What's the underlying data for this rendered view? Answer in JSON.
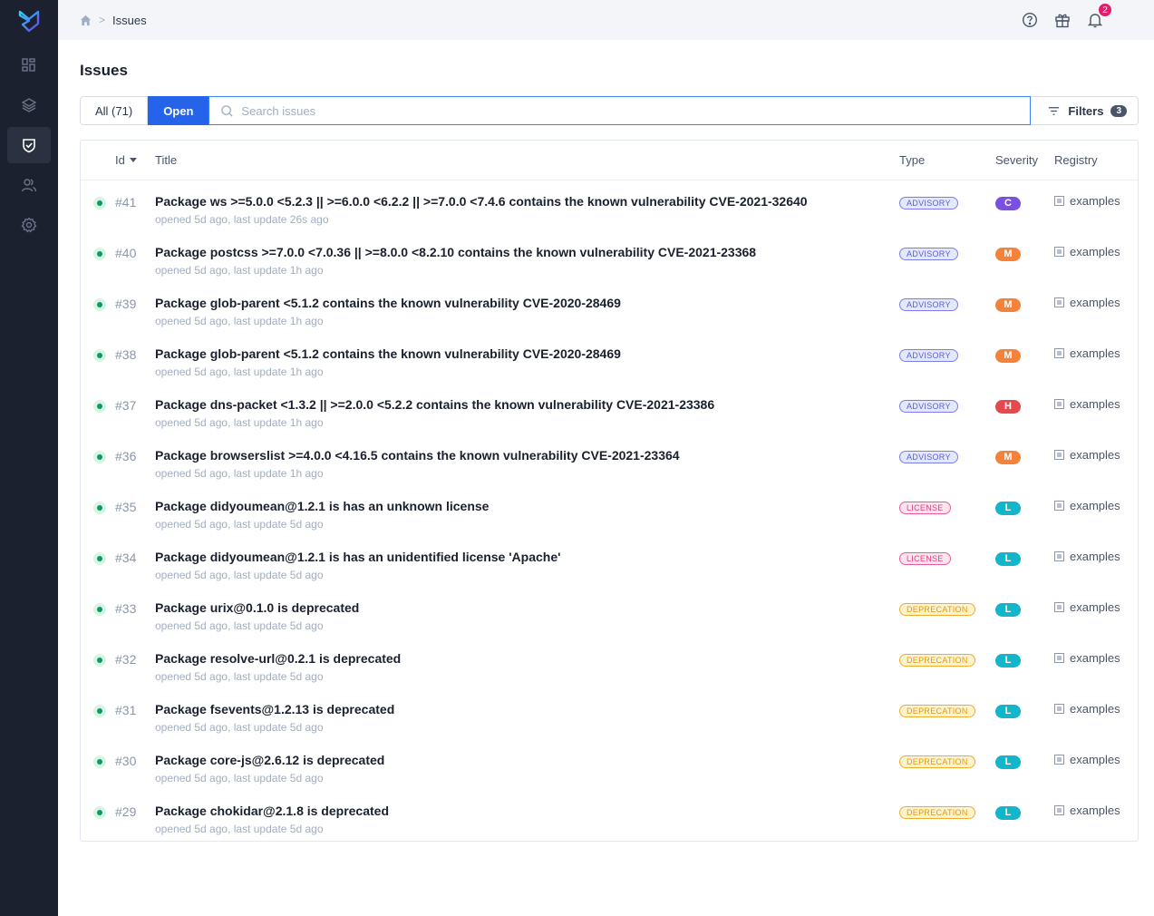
{
  "sidebar": {
    "logo": "app-logo",
    "items": [
      {
        "name": "dashboard",
        "icon": "dashboard-icon",
        "active": false
      },
      {
        "name": "layers",
        "icon": "layers-icon",
        "active": false
      },
      {
        "name": "issues",
        "icon": "shield-check-icon",
        "active": true
      },
      {
        "name": "users",
        "icon": "users-icon",
        "active": false
      },
      {
        "name": "settings",
        "icon": "gear-icon",
        "active": false
      }
    ]
  },
  "topbar": {
    "breadcrumb": {
      "home": "home-icon",
      "separator": ">",
      "current": "Issues"
    },
    "notifications_count": "2"
  },
  "page": {
    "title": "Issues",
    "tabs": {
      "all": "All (71)",
      "open": "Open"
    },
    "search": {
      "placeholder": "Search issues",
      "value": ""
    },
    "filters": {
      "label": "Filters",
      "count": "3"
    }
  },
  "table": {
    "headers": {
      "id": "Id",
      "title": "Title",
      "type": "Type",
      "severity": "Severity",
      "registry": "Registry"
    },
    "rows": [
      {
        "id": "#41",
        "title": "Package ws >=5.0.0 <5.2.3 || >=6.0.0 <6.2.2 || >=7.0.0 <7.4.6 contains the known vulnerability CVE-2021-32640",
        "sub": "opened 5d ago, last update 26s ago",
        "type": "ADVISORY",
        "severity": "C",
        "registry": "examples"
      },
      {
        "id": "#40",
        "title": "Package postcss >=7.0.0 <7.0.36 || >=8.0.0 <8.2.10 contains the known vulnerability CVE-2021-23368",
        "sub": "opened 5d ago, last update 1h ago",
        "type": "ADVISORY",
        "severity": "M",
        "registry": "examples"
      },
      {
        "id": "#39",
        "title": "Package glob-parent <5.1.2 contains the known vulnerability CVE-2020-28469",
        "sub": "opened 5d ago, last update 1h ago",
        "type": "ADVISORY",
        "severity": "M",
        "registry": "examples"
      },
      {
        "id": "#38",
        "title": "Package glob-parent <5.1.2 contains the known vulnerability CVE-2020-28469",
        "sub": "opened 5d ago, last update 1h ago",
        "type": "ADVISORY",
        "severity": "M",
        "registry": "examples"
      },
      {
        "id": "#37",
        "title": "Package dns-packet <1.3.2 || >=2.0.0 <5.2.2 contains the known vulnerability CVE-2021-23386",
        "sub": "opened 5d ago, last update 1h ago",
        "type": "ADVISORY",
        "severity": "H",
        "registry": "examples"
      },
      {
        "id": "#36",
        "title": "Package browserslist >=4.0.0 <4.16.5 contains the known vulnerability CVE-2021-23364",
        "sub": "opened 5d ago, last update 1h ago",
        "type": "ADVISORY",
        "severity": "M",
        "registry": "examples"
      },
      {
        "id": "#35",
        "title": "Package didyoumean@1.2.1 is has an unknown license",
        "sub": "opened 5d ago, last update 5d ago",
        "type": "LICENSE",
        "severity": "L",
        "registry": "examples"
      },
      {
        "id": "#34",
        "title": "Package didyoumean@1.2.1 is has an unidentified license 'Apache'",
        "sub": "opened 5d ago, last update 5d ago",
        "type": "LICENSE",
        "severity": "L",
        "registry": "examples"
      },
      {
        "id": "#33",
        "title": "Package urix@0.1.0 is deprecated",
        "sub": "opened 5d ago, last update 5d ago",
        "type": "DEPRECATION",
        "severity": "L",
        "registry": "examples"
      },
      {
        "id": "#32",
        "title": "Package resolve-url@0.2.1 is deprecated",
        "sub": "opened 5d ago, last update 5d ago",
        "type": "DEPRECATION",
        "severity": "L",
        "registry": "examples"
      },
      {
        "id": "#31",
        "title": "Package fsevents@1.2.13 is deprecated",
        "sub": "opened 5d ago, last update 5d ago",
        "type": "DEPRECATION",
        "severity": "L",
        "registry": "examples"
      },
      {
        "id": "#30",
        "title": "Package core-js@2.6.12 is deprecated",
        "sub": "opened 5d ago, last update 5d ago",
        "type": "DEPRECATION",
        "severity": "L",
        "registry": "examples"
      },
      {
        "id": "#29",
        "title": "Package chokidar@2.1.8 is deprecated",
        "sub": "opened 5d ago, last update 5d ago",
        "type": "DEPRECATION",
        "severity": "L",
        "registry": "examples"
      }
    ]
  },
  "colors": {
    "sidebar_bg": "#1b212f",
    "accent": "#2563eb",
    "status_open": "#0d9a5e",
    "severity": {
      "C": "#7b4fe0",
      "H": "#e5484d",
      "M": "#f4823a",
      "L": "#12b5c9"
    },
    "notification": "#e31c6b"
  }
}
